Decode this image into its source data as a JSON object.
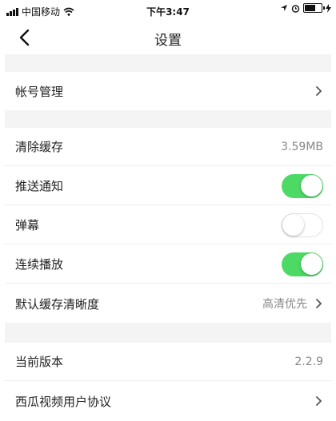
{
  "status_bar": {
    "carrier": "中国移动",
    "time": "下午3:47"
  },
  "nav": {
    "title": "设置"
  },
  "settings": {
    "account": {
      "label": "帐号管理"
    },
    "clear_cache": {
      "label": "清除缓存",
      "value": "3.59MB"
    },
    "push": {
      "label": "推送通知",
      "on": true
    },
    "danmaku": {
      "label": "弹幕",
      "on": false
    },
    "autoplay": {
      "label": "连续播放",
      "on": true
    },
    "quality": {
      "label": "默认缓存清晰度",
      "value": "高清优先"
    },
    "version": {
      "label": "当前版本",
      "value": "2.2.9"
    },
    "agreement": {
      "label": "西瓜视频用户协议"
    }
  },
  "colors": {
    "toggle_on": "#4cd964",
    "section_gap": "#f4f4f4"
  }
}
